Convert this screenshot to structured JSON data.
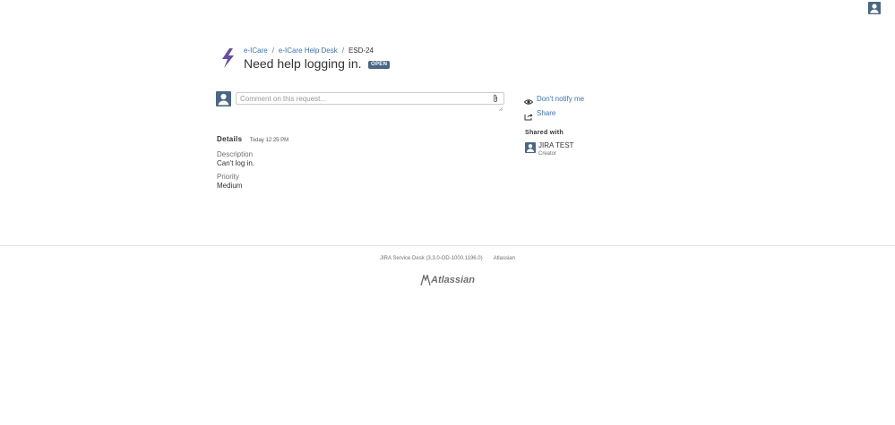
{
  "header": {
    "breadcrumbs": [
      "e-ICare",
      "e-ICare Help Desk",
      "ESD-24"
    ],
    "title": "Need help logging in.",
    "status": "OPEN"
  },
  "comment": {
    "placeholder": "Comment on this request..."
  },
  "actions": {
    "notify_label": "Don't notify me",
    "share_label": "Share"
  },
  "details": {
    "heading": "Details",
    "timestamp": "Today 12:25 PM",
    "fields": [
      {
        "label": "Description",
        "value": "Can't log in."
      },
      {
        "label": "Priority",
        "value": "Medium"
      }
    ]
  },
  "shared_with": {
    "heading": "Shared with",
    "users": [
      {
        "name": "JIRA TEST",
        "role": "Creator"
      }
    ]
  },
  "footer": {
    "version": "JIRA Service Desk (3.3.0-OD-1000.1196.0)",
    "atlassian_link": "Atlassian",
    "logo_text": "Atlassian"
  },
  "colors": {
    "link": "#3b73af",
    "avatar": "#4a6785",
    "status_lozenge": "#4a6785"
  }
}
